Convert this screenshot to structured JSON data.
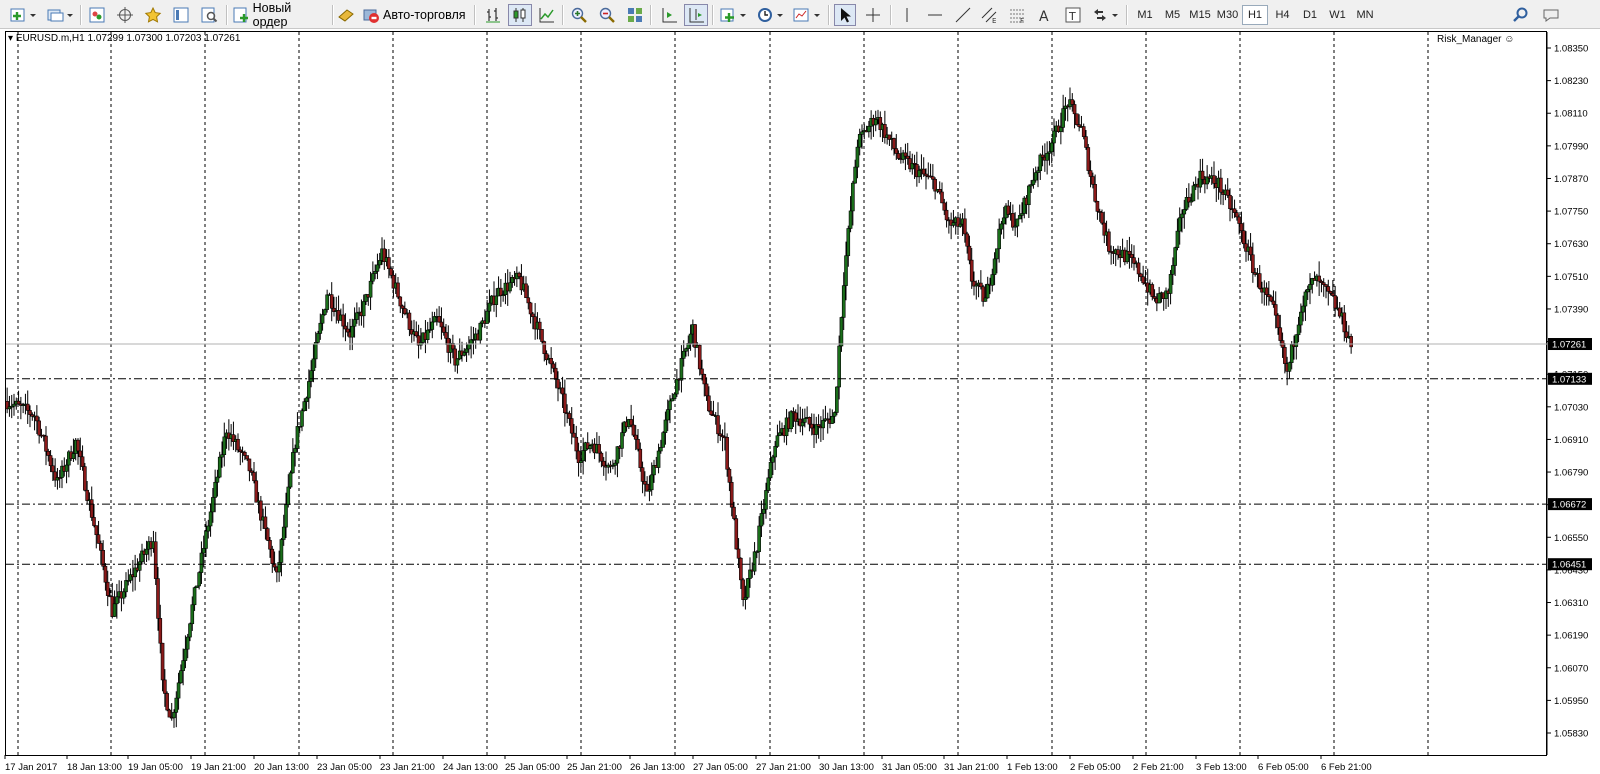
{
  "toolbar": {
    "new_order_label": "Новый ордер",
    "auto_trading_label": "Авто-торговля",
    "timeframes": [
      "M1",
      "M5",
      "M15",
      "M30",
      "H1",
      "H4",
      "D1",
      "W1",
      "MN"
    ],
    "active_timeframe": "H1"
  },
  "chart": {
    "symbol_info": "EURUSD.m,H1  1.07299 1.07300 1.07203 1.07261",
    "expert_name": "Risk_Manager",
    "current_price_label": "1.07261"
  },
  "colors": {
    "bull": "#1a6e1a",
    "bear": "#8b1a1a",
    "grid": "#000000",
    "price_tag_bg": "#000000"
  },
  "chart_data": {
    "type": "candlestick",
    "price_axis_ticks": [
      "1.08350",
      "1.08230",
      "1.08110",
      "1.07990",
      "1.07870",
      "1.07750",
      "1.07630",
      "1.07510",
      "1.07390",
      "1.07270",
      "1.07150",
      "1.07030",
      "1.06910",
      "1.06790",
      "1.06670",
      "1.06550",
      "1.06430",
      "1.06310",
      "1.06190",
      "1.06070",
      "1.05950",
      "1.05830"
    ],
    "time_axis_labels": [
      "17 Jan 2017",
      "18 Jan 13:00",
      "19 Jan 05:00",
      "19 Jan 21:00",
      "20 Jan 13:00",
      "23 Jan 05:00",
      "23 Jan 21:00",
      "24 Jan 13:00",
      "25 Jan 05:00",
      "25 Jan 21:00",
      "26 Jan 13:00",
      "27 Jan 05:00",
      "27 Jan 21:00",
      "30 Jan 13:00",
      "31 Jan 05:00",
      "31 Jan 21:00",
      "1 Feb 13:00",
      "2 Feb 05:00",
      "2 Feb 21:00",
      "3 Feb 13:00",
      "6 Feb 05:00",
      "6 Feb 21:00"
    ],
    "horizontal_levels": [
      {
        "price": 1.07133,
        "label": "1.07133"
      },
      {
        "price": 1.06672,
        "label": "1.06672"
      },
      {
        "price": 1.06451,
        "label": "1.06451"
      }
    ],
    "current_price": 1.07261,
    "ylim": [
      1.0583,
      1.0835
    ],
    "path_points": [
      [
        0,
        1.0705
      ],
      [
        12,
        1.07
      ],
      [
        22,
        1.0675
      ],
      [
        30,
        1.069
      ],
      [
        38,
        1.066
      ],
      [
        46,
        1.0628
      ],
      [
        54,
        1.064
      ],
      [
        64,
        1.0655
      ],
      [
        68,
        1.06
      ],
      [
        72,
        1.0588
      ],
      [
        80,
        1.0625
      ],
      [
        88,
        1.066
      ],
      [
        96,
        1.0695
      ],
      [
        106,
        1.068
      ],
      [
        112,
        1.066
      ],
      [
        118,
        1.064
      ],
      [
        126,
        1.069
      ],
      [
        134,
        1.072
      ],
      [
        140,
        1.0745
      ],
      [
        150,
        1.073
      ],
      [
        156,
        1.074
      ],
      [
        164,
        1.076
      ],
      [
        172,
        1.0742
      ],
      [
        180,
        1.0725
      ],
      [
        188,
        1.0735
      ],
      [
        196,
        1.072
      ],
      [
        206,
        1.073
      ],
      [
        214,
        1.0745
      ],
      [
        224,
        1.075
      ],
      [
        232,
        1.0732
      ],
      [
        242,
        1.0708
      ],
      [
        250,
        1.0685
      ],
      [
        256,
        1.069
      ],
      [
        264,
        1.068
      ],
      [
        272,
        1.07
      ],
      [
        280,
        1.067
      ],
      [
        286,
        1.069
      ],
      [
        292,
        1.071
      ],
      [
        300,
        1.0732
      ],
      [
        306,
        1.0705
      ],
      [
        314,
        1.069
      ],
      [
        322,
        1.063
      ],
      [
        328,
        1.0652
      ],
      [
        336,
        1.069
      ],
      [
        344,
        1.07
      ],
      [
        354,
        1.0695
      ],
      [
        362,
        1.07
      ],
      [
        366,
        1.075
      ],
      [
        372,
        1.08
      ],
      [
        380,
        1.081
      ],
      [
        390,
        1.0795
      ],
      [
        398,
        1.079
      ],
      [
        406,
        1.0785
      ],
      [
        412,
        1.077
      ],
      [
        418,
        1.077
      ],
      [
        422,
        1.075
      ],
      [
        428,
        1.0742
      ],
      [
        436,
        1.0775
      ],
      [
        442,
        1.077
      ],
      [
        450,
        1.079
      ],
      [
        458,
        1.0802
      ],
      [
        464,
        1.0815
      ],
      [
        470,
        1.0805
      ],
      [
        476,
        1.078
      ],
      [
        482,
        1.0762
      ],
      [
        490,
        1.0758
      ],
      [
        496,
        1.0752
      ],
      [
        502,
        1.0742
      ],
      [
        508,
        1.0745
      ],
      [
        514,
        1.0775
      ],
      [
        522,
        1.0788
      ],
      [
        530,
        1.0785
      ],
      [
        538,
        1.0772
      ],
      [
        546,
        1.0752
      ],
      [
        554,
        1.0738
      ],
      [
        560,
        1.0715
      ],
      [
        566,
        1.074
      ],
      [
        572,
        1.075
      ],
      [
        580,
        1.0742
      ],
      [
        584,
        1.0735
      ],
      [
        588,
        1.0726
      ]
    ]
  }
}
